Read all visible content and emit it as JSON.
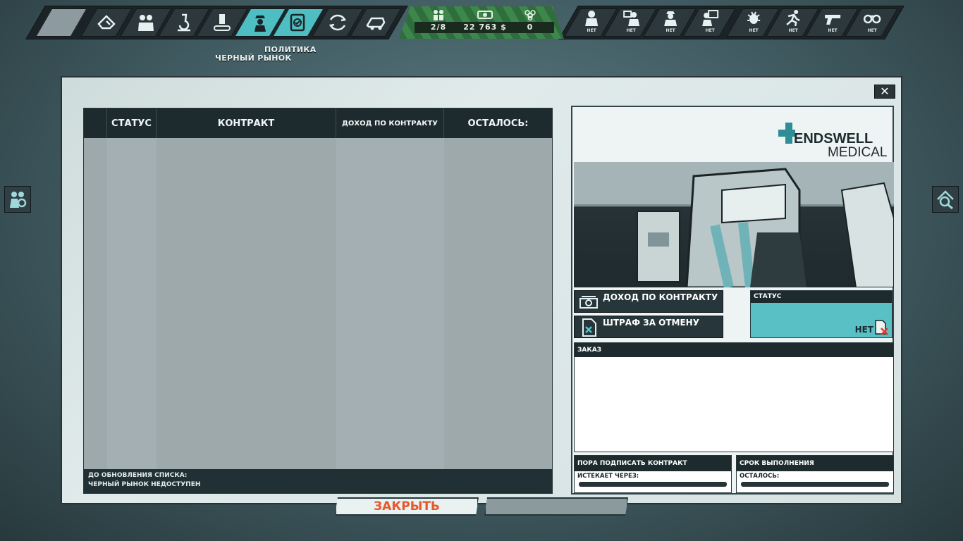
{
  "toolbar": {
    "active_tab_label": "ПОЛИТИКА",
    "hover_label": "ЧЕРНЫЙ РЫНОК",
    "icons": [
      "blank-icon",
      "build-icon",
      "staff-icon",
      "research-icon",
      "production-icon",
      "black-market-icon",
      "policy-icon",
      "logistics-icon",
      "transport-icon"
    ]
  },
  "resources": {
    "staff": "2/8",
    "money": "22 763 $",
    "biohazard": "0"
  },
  "staff_slots": {
    "net_label": "НЕТ",
    "icons": [
      "doctor-slot-icon",
      "manager-slot-icon",
      "worker-slot-icon",
      "analyst-slot-icon",
      "virus-slot-icon",
      "runner-slot-icon",
      "gun-slot-icon",
      "handcuffs-slot-icon"
    ]
  },
  "table": {
    "headers": {
      "status": "СТАТУС",
      "contract": "КОНТРАКТ",
      "income": "ДОХОД ПО КОНТРАКТУ",
      "remaining": "ОСТАЛОСЬ:"
    },
    "footer_line1": "ДО ОБНОВЛЕНИЯ СПИСКА:",
    "footer_line2": "ЧЕРНЫЙ РЫНОК НЕДОСТУПЕН"
  },
  "details": {
    "logo_line1": "ENDSWELL",
    "logo_line2": "MEDICAL",
    "income_label": "ДОХОД ПО КОНТРАКТУ",
    "penalty_label": "ШТРАФ ЗА ОТМЕНУ",
    "status_label": "СТАТУС",
    "status_value": "НЕТ",
    "order_label": "ЗАКАЗ",
    "sign_header": "ПОРА ПОДПИСАТЬ КОНТРАКТ",
    "sign_sub": "ИСТЕКАЕТ ЧЕРЕЗ:",
    "deadline_header": "СРОК ВЫПОЛНЕНИЯ",
    "deadline_sub": "ОСТАЛОСЬ:"
  },
  "buttons": {
    "close_label": "ЗАКРЫТЬ",
    "close_x": "✕"
  },
  "colors": {
    "accent_teal": "#59c1c6",
    "close_text": "#e8572b",
    "resource_green": "#3d874b"
  }
}
